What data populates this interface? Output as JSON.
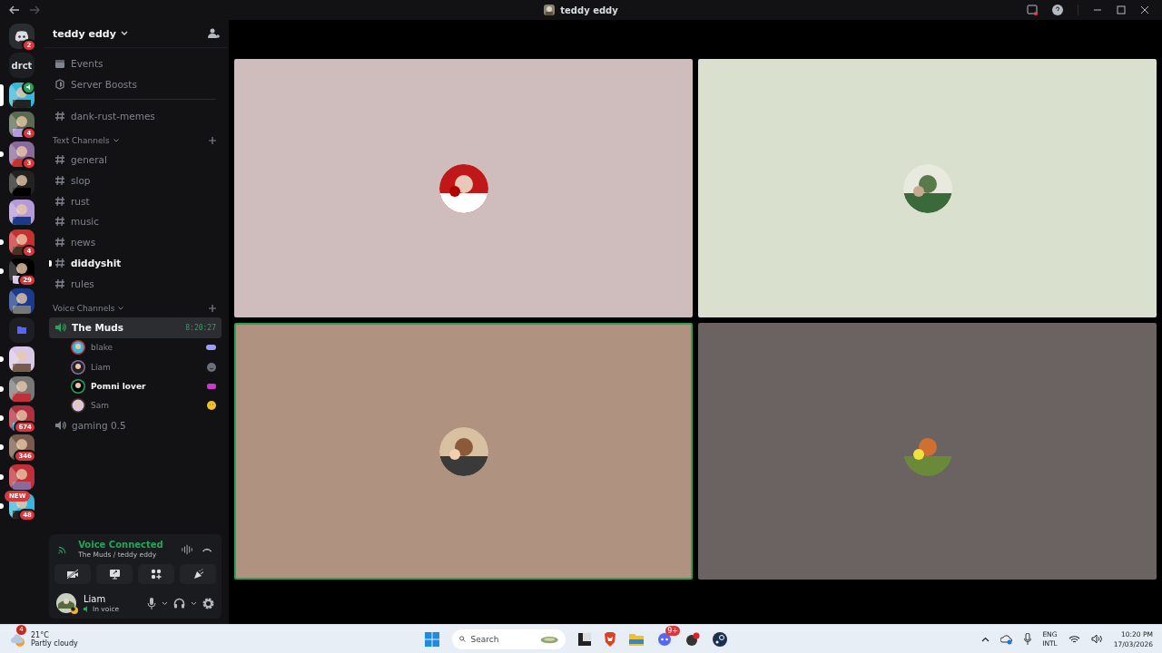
{
  "window": {
    "title": "teddy eddy"
  },
  "servers": [
    {
      "kind": "home",
      "badge": "2",
      "unread": false,
      "selected": false
    },
    {
      "kind": "label",
      "label": "drct",
      "unread": false,
      "selected": false
    },
    {
      "kind": "picture",
      "voice": true,
      "selected": true
    },
    {
      "kind": "picture",
      "badge": "4",
      "unread": false,
      "selected": false
    },
    {
      "kind": "picture",
      "badge": "3",
      "unread": true,
      "selected": false
    },
    {
      "kind": "picture",
      "unread": false,
      "selected": false
    },
    {
      "kind": "picture",
      "unread": false,
      "selected": false
    },
    {
      "kind": "picture",
      "badge": "4",
      "unread": true,
      "selected": false
    },
    {
      "kind": "picture",
      "badge": "29",
      "unread": true,
      "selected": false
    },
    {
      "kind": "picture",
      "unread": false,
      "selected": false
    },
    {
      "kind": "folder",
      "unread": false,
      "selected": false
    },
    {
      "kind": "picture",
      "unread": true,
      "selected": false
    },
    {
      "kind": "picture",
      "unread": true,
      "selected": false
    },
    {
      "kind": "picture",
      "badge": "674",
      "unread": true,
      "selected": false
    },
    {
      "kind": "picture",
      "badge": "346",
      "unread": true,
      "selected": false
    },
    {
      "kind": "picture",
      "unread": true,
      "selected": false
    },
    {
      "kind": "picture",
      "badge": "48",
      "pill": "NEW",
      "unread": true,
      "selected": false
    }
  ],
  "server": {
    "name": "teddy eddy"
  },
  "links": [
    {
      "kind": "events",
      "label": "Events"
    },
    {
      "kind": "boosts",
      "label": "Server Boosts"
    }
  ],
  "pinned_channels": [
    {
      "name": "dank-rust-memes",
      "unread": false
    }
  ],
  "text_category": "Text Channels",
  "text_channels": [
    {
      "name": "general",
      "unread": false
    },
    {
      "name": "slop",
      "unread": false
    },
    {
      "name": "rust",
      "unread": false
    },
    {
      "name": "music",
      "unread": false
    },
    {
      "name": "news",
      "unread": false
    },
    {
      "name": "diddyshit",
      "unread": true
    },
    {
      "name": "rules",
      "unread": false
    }
  ],
  "voice_category": "Voice Channels",
  "voice_channels": [
    {
      "name": "The Muds",
      "selected": true,
      "timer": "8:20:27",
      "members": [
        {
          "name": "blake",
          "speaking": false
        },
        {
          "name": "Liam",
          "speaking": false
        },
        {
          "name": "Pomni lover",
          "speaking": true
        },
        {
          "name": "Sam",
          "speaking": false
        }
      ]
    },
    {
      "name": "gaming 0.5",
      "selected": false
    }
  ],
  "voice_panel": {
    "status": "Voice Connected",
    "location": "The Muds / teddy eddy"
  },
  "user": {
    "name": "Liam",
    "status": "In voice"
  },
  "tiles": [
    {
      "color": "#cfbcbc",
      "speaking": false
    },
    {
      "color": "#d9e0cd",
      "speaking": false
    },
    {
      "color": "#b09280",
      "speaking": true
    },
    {
      "color": "#6b6361",
      "speaking": false
    }
  ],
  "taskbar": {
    "weather_badge": "4",
    "temperature": "21°C",
    "weather": "Partly cloudy",
    "search_placeholder": "Search",
    "discord_badge": "9+",
    "language": "ENG",
    "layout": "INTL",
    "time": "10:20 PM",
    "date": "17/03/2026"
  }
}
